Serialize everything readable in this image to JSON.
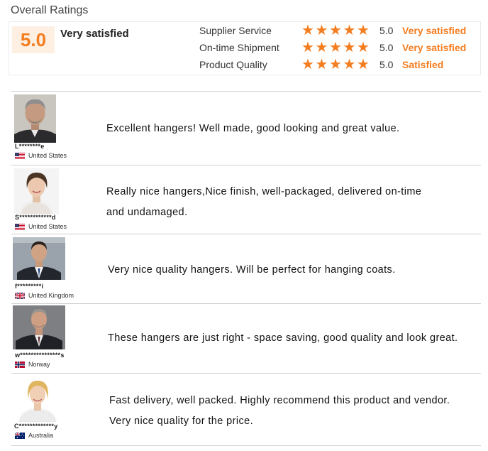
{
  "section_title": "Overall Ratings",
  "summary": {
    "score": "5.0",
    "label": "Very satisfied",
    "categories": [
      {
        "name": "Supplier Service",
        "stars": 5,
        "score": "5.0",
        "label": "Very satisfied"
      },
      {
        "name": "On-time Shipment",
        "stars": 5,
        "score": "5.0",
        "label": "Very satisfied"
      },
      {
        "name": "Product Quality",
        "stars": 5,
        "score": "5.0",
        "label": "Satisfied"
      }
    ]
  },
  "colors": {
    "accent": "#f47d20",
    "badge_bg": "#fdf0e3",
    "divider": "#cfcfcf"
  },
  "reviews": [
    {
      "name": "L********e",
      "country": "United States",
      "flag": "us-flag",
      "text": "Excellent hangers! Well made, good looking and great value."
    },
    {
      "name": "S************d",
      "country": "United States",
      "flag": "us-flag",
      "text_line1": "Really nice hangers,Nice finish, well-packaged, delivered on-time",
      "text_line2": "and undamaged."
    },
    {
      "name": "f*********i",
      "country": "United Kingdom",
      "flag": "uk-flag",
      "text": "Very nice quality hangers. Will be perfect for hanging coats."
    },
    {
      "name": "w***************s",
      "country": "Norway",
      "flag": "norway-flag",
      "text": "These hangers are just right - space saving, good quality and look great."
    },
    {
      "name": "C*************y",
      "country": "Australia",
      "flag": "australia-flag",
      "text_line1": "Fast delivery, well packed. Highly recommend this product and vendor.",
      "text_line2": "Very nice quality for the price."
    }
  ]
}
